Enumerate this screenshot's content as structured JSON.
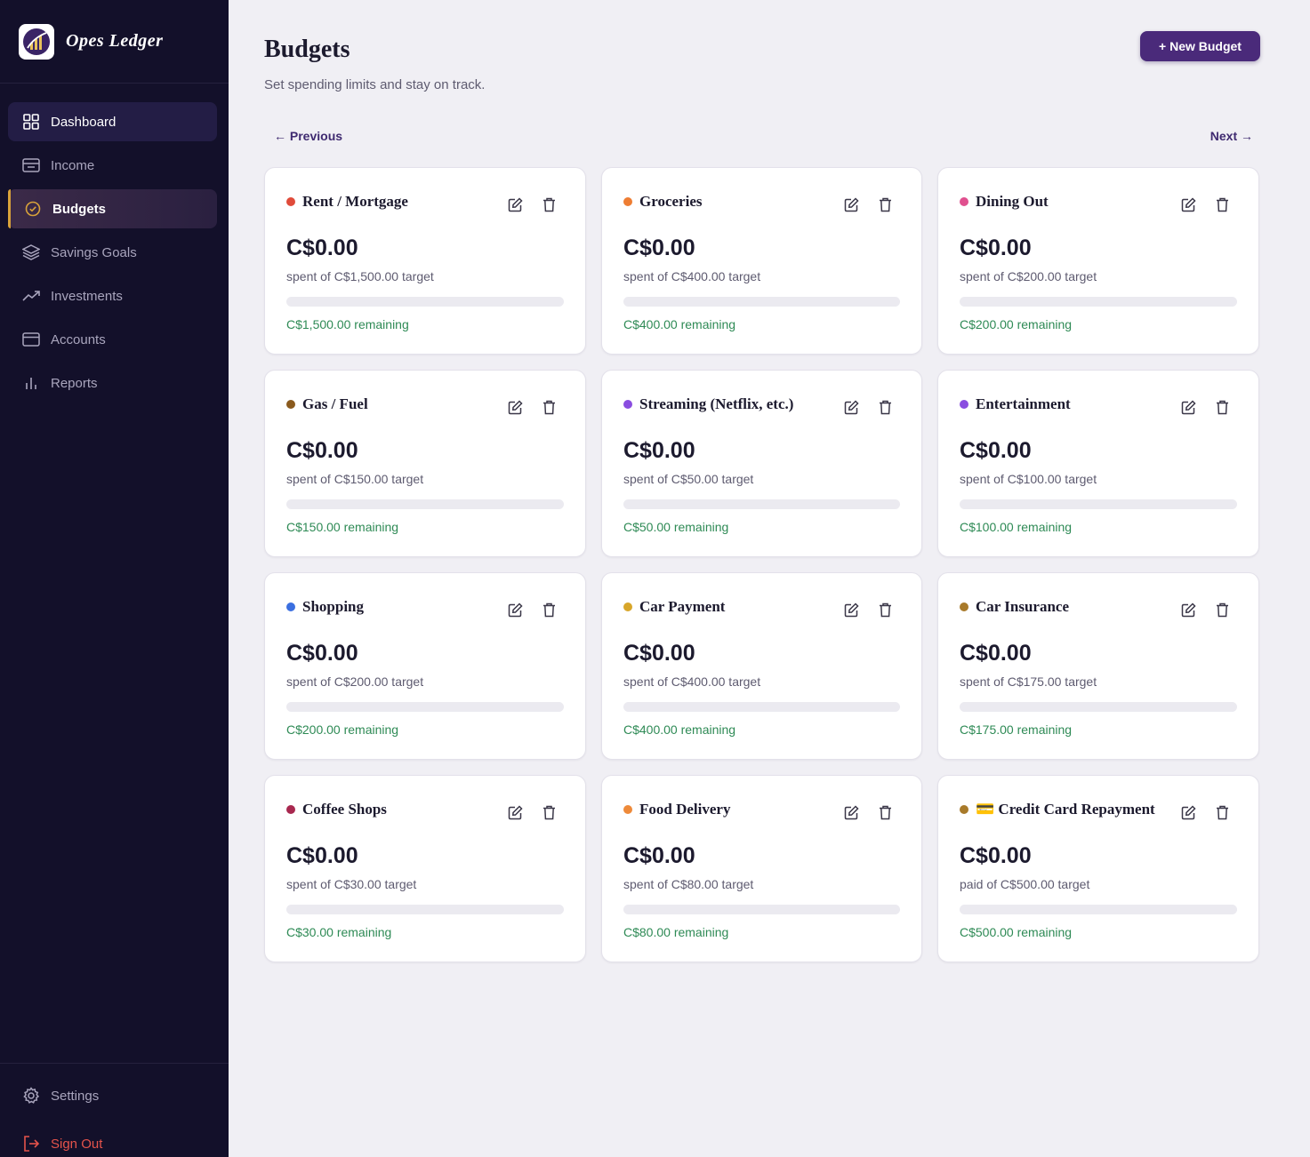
{
  "brand": {
    "name": "Opes Ledger"
  },
  "sidebar": {
    "items": [
      {
        "label": "Dashboard",
        "icon": "dashboard-grid-icon"
      },
      {
        "label": "Income",
        "icon": "wallet-icon"
      },
      {
        "label": "Budgets",
        "icon": "check-circle-icon"
      },
      {
        "label": "Savings Goals",
        "icon": "layers-icon"
      },
      {
        "label": "Investments",
        "icon": "trending-up-icon"
      },
      {
        "label": "Accounts",
        "icon": "card-icon"
      },
      {
        "label": "Reports",
        "icon": "bar-chart-icon"
      }
    ],
    "active": "Budgets",
    "settings_label": "Settings",
    "signout_label": "Sign Out"
  },
  "header": {
    "title": "Budgets",
    "subtitle": "Set spending limits and stay on track.",
    "new_button": "+ New Budget"
  },
  "pager": {
    "previous": "← Previous",
    "next": "Next →"
  },
  "colors": {
    "accent": "#4a2a7a",
    "remaining_text": "#2e8a55",
    "sidebar_bg": "#13102a",
    "active_marker": "#d8a23a",
    "signout": "#e5534b"
  },
  "budgets": [
    {
      "name": "Rent / Mortgage",
      "color": "#e04b3a",
      "amount": "C$0.00",
      "target_text": "spent of C$1,500.00 target",
      "progress": 0,
      "remaining": "C$1,500.00 remaining"
    },
    {
      "name": "Groceries",
      "color": "#ee7d33",
      "amount": "C$0.00",
      "target_text": "spent of C$400.00 target",
      "progress": 0,
      "remaining": "C$400.00 remaining"
    },
    {
      "name": "Dining Out",
      "color": "#e0508f",
      "amount": "C$0.00",
      "target_text": "spent of C$200.00 target",
      "progress": 0,
      "remaining": "C$200.00 remaining"
    },
    {
      "name": "Gas / Fuel",
      "color": "#8a5a1e",
      "amount": "C$0.00",
      "target_text": "spent of C$150.00 target",
      "progress": 0,
      "remaining": "C$150.00 remaining"
    },
    {
      "name": "Streaming (Netflix, etc.)",
      "color": "#8a4de0",
      "amount": "C$0.00",
      "target_text": "spent of C$50.00 target",
      "progress": 0,
      "remaining": "C$50.00 remaining"
    },
    {
      "name": "Entertainment",
      "color": "#8a4de0",
      "amount": "C$0.00",
      "target_text": "spent of C$100.00 target",
      "progress": 0,
      "remaining": "C$100.00 remaining"
    },
    {
      "name": "Shopping",
      "color": "#3b6fe0",
      "amount": "C$0.00",
      "target_text": "spent of C$200.00 target",
      "progress": 0,
      "remaining": "C$200.00 remaining"
    },
    {
      "name": "Car Payment",
      "color": "#d8a62a",
      "amount": "C$0.00",
      "target_text": "spent of C$400.00 target",
      "progress": 0,
      "remaining": "C$400.00 remaining"
    },
    {
      "name": "Car Insurance",
      "color": "#a87a2a",
      "amount": "C$0.00",
      "target_text": "spent of C$175.00 target",
      "progress": 0,
      "remaining": "C$175.00 remaining"
    },
    {
      "name": "Coffee Shops",
      "color": "#a8284f",
      "amount": "C$0.00",
      "target_text": "spent of C$30.00 target",
      "progress": 0,
      "remaining": "C$30.00 remaining"
    },
    {
      "name": "Food Delivery",
      "color": "#ee8a3a",
      "amount": "C$0.00",
      "target_text": "spent of C$80.00 target",
      "progress": 0,
      "remaining": "C$80.00 remaining"
    },
    {
      "name": "💳 Credit Card Repayment",
      "color": "#a87a2a",
      "amount": "C$0.00",
      "target_text": "paid of C$500.00 target",
      "progress": 0,
      "remaining": "C$500.00 remaining"
    }
  ]
}
